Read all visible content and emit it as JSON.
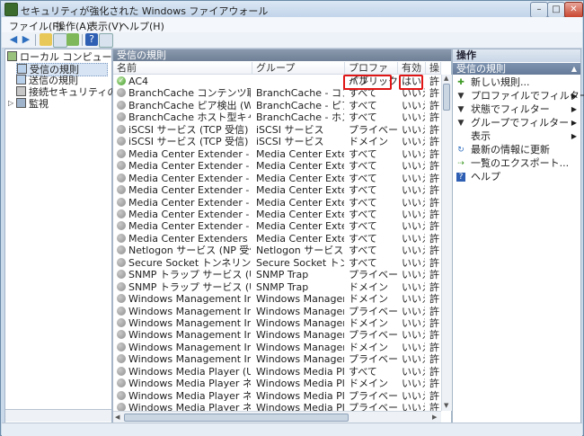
{
  "window": {
    "title": "セキュリティが強化された Windows ファイアウォール",
    "minimize": "–",
    "maximize": "□",
    "close": "✕"
  },
  "menu": [
    "ファイル(F)",
    "操作(A)",
    "表示(V)",
    "ヘルプ(H)"
  ],
  "tree": {
    "root": "ローカル コンピューター のセ",
    "inbound": "受信の規則",
    "outbound": "送信の規則",
    "connection": "接続セキュリティの規則",
    "monitor": "監視"
  },
  "center": {
    "pane_title": "受信の規則",
    "columns": [
      "名前",
      "グループ",
      "プロファイル",
      "有効",
      "操"
    ],
    "rows": [
      {
        "name": "AC4",
        "group": "",
        "profile": "パブリック",
        "enabled": "はい",
        "action": "許",
        "on": true
      },
      {
        "name": "BranchCache コンテンツ取得 (HTTP-...",
        "group": "BranchCache - コンテン...",
        "profile": "すべて",
        "enabled": "いいえ",
        "action": "許"
      },
      {
        "name": "BranchCache ピア検出 (WSD-受信)",
        "group": "BranchCache - ピア検出 ...",
        "profile": "すべて",
        "enabled": "いいえ",
        "action": "許"
      },
      {
        "name": "BranchCache ホスト型キャッシュ サ...",
        "group": "BranchCache - ホスト型...",
        "profile": "すべて",
        "enabled": "いいえ",
        "action": "許"
      },
      {
        "name": "iSCSI サービス (TCP 受信)",
        "group": "iSCSI サービス",
        "profile": "プライベート...",
        "enabled": "いいえ",
        "action": "許"
      },
      {
        "name": "iSCSI サービス (TCP 受信)",
        "group": "iSCSI サービス",
        "profile": "ドメイン",
        "enabled": "いいえ",
        "action": "許"
      },
      {
        "name": "Media Center Extender - HTTP スト...",
        "group": "Media Center Extender",
        "profile": "すべて",
        "enabled": "いいえ",
        "action": "許"
      },
      {
        "name": "Media Center Extender - qWave (TC...",
        "group": "Media Center Extender",
        "profile": "すべて",
        "enabled": "いいえ",
        "action": "許"
      },
      {
        "name": "Media Center Extender - qWave (UD...",
        "group": "Media Center Extender",
        "profile": "すべて",
        "enabled": "いいえ",
        "action": "許"
      },
      {
        "name": "Media Center Extender - RTSP (TCP ...",
        "group": "Media Center Extender",
        "profile": "すべて",
        "enabled": "いいえ",
        "action": "許"
      },
      {
        "name": "Media Center Extender - SSDP (UDP...",
        "group": "Media Center Extender",
        "profile": "すべて",
        "enabled": "いいえ",
        "action": "許"
      },
      {
        "name": "Media Center Extender - WMDRM-N...",
        "group": "Media Center Extender",
        "profile": "すべて",
        "enabled": "いいえ",
        "action": "許"
      },
      {
        "name": "Media Center Extender - XSP (TCP ...",
        "group": "Media Center Extender",
        "profile": "すべて",
        "enabled": "いいえ",
        "action": "許"
      },
      {
        "name": "Media Center Extenders - Media スト...",
        "group": "Media Center Extender",
        "profile": "すべて",
        "enabled": "いいえ",
        "action": "許"
      },
      {
        "name": "Netlogon サービス (NP 受信)",
        "group": "Netlogon サービス",
        "profile": "すべて",
        "enabled": "いいえ",
        "action": "許"
      },
      {
        "name": "Secure Socket トンネリング プロトコ...",
        "group": "Secure Socket トンネリ...",
        "profile": "すべて",
        "enabled": "いいえ",
        "action": "許"
      },
      {
        "name": "SNMP トラップ サービス (UDP 受信)",
        "group": "SNMP Trap",
        "profile": "プライベート...",
        "enabled": "いいえ",
        "action": "許"
      },
      {
        "name": "SNMP トラップ サービス (UDP 受信)",
        "group": "SNMP Trap",
        "profile": "ドメイン",
        "enabled": "いいえ",
        "action": "許"
      },
      {
        "name": "Windows Management Instrumentat...",
        "group": "Windows Management I...",
        "profile": "ドメイン",
        "enabled": "いいえ",
        "action": "許"
      },
      {
        "name": "Windows Management Instrumentat...",
        "group": "Windows Management I...",
        "profile": "プライベート...",
        "enabled": "いいえ",
        "action": "許"
      },
      {
        "name": "Windows Management Instrumentat...",
        "group": "Windows Management I...",
        "profile": "ドメイン",
        "enabled": "いいえ",
        "action": "許"
      },
      {
        "name": "Windows Management Instrumentat...",
        "group": "Windows Management I...",
        "profile": "プライベート...",
        "enabled": "いいえ",
        "action": "許"
      },
      {
        "name": "Windows Management Instrumentat...",
        "group": "Windows Management I...",
        "profile": "ドメイン",
        "enabled": "いいえ",
        "action": "許"
      },
      {
        "name": "Windows Management Instrumentat...",
        "group": "Windows Management I...",
        "profile": "プライベート...",
        "enabled": "いいえ",
        "action": "許"
      },
      {
        "name": "Windows Media Player (UDP 受信)",
        "group": "Windows Media Player",
        "profile": "すべて",
        "enabled": "いいえ",
        "action": "許"
      },
      {
        "name": "Windows Media Player ネットワーク...",
        "group": "Windows Media Player ネ...",
        "profile": "ドメイン",
        "enabled": "いいえ",
        "action": "許"
      },
      {
        "name": "Windows Media Player ネットワーク...",
        "group": "Windows Media Player ネ...",
        "profile": "プライベート...",
        "enabled": "いいえ",
        "action": "許"
      },
      {
        "name": "Windows Media Player ネットワーク",
        "group": "Windows Media Player ネ",
        "profile": "プライベート",
        "enabled": "いいえ",
        "action": "許"
      }
    ]
  },
  "actions": {
    "header": "操作",
    "section": "受信の規則",
    "items": [
      {
        "label": "新しい規則...",
        "icon": "new-rule-icon",
        "glyph": "✚",
        "submenu": false
      },
      {
        "label": "プロファイルでフィルター",
        "icon": "filter-icon",
        "glyph": "▼",
        "submenu": true
      },
      {
        "label": "状態でフィルター",
        "icon": "filter-icon",
        "glyph": "▼",
        "submenu": true
      },
      {
        "label": "グループでフィルター",
        "icon": "filter-icon",
        "glyph": "▼",
        "submenu": true
      },
      {
        "label": "表示",
        "icon": "",
        "glyph": "",
        "submenu": true
      },
      {
        "label": "最新の情報に更新",
        "icon": "refresh-icon",
        "glyph": "↻",
        "submenu": false
      },
      {
        "label": "一覧のエクスポート...",
        "icon": "export-icon",
        "glyph": "⇢",
        "submenu": false
      },
      {
        "label": "ヘルプ",
        "icon": "help-icon",
        "glyph": "?",
        "submenu": false
      }
    ]
  },
  "colors": {
    "highlight": "#e01515",
    "pane_header": "#6f7f95",
    "enabled_icon": "#3e9a25"
  }
}
